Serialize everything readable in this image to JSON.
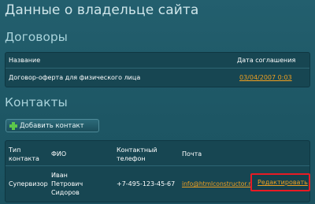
{
  "page": {
    "title": "Данные о владельце сайта"
  },
  "contracts": {
    "section_title": "Договоры",
    "headers": {
      "name": "Название",
      "date": "Дата соглашения"
    },
    "rows": [
      {
        "name": "Договор-оферта для физического лица",
        "date": "03/04/2007 0:03"
      }
    ]
  },
  "contacts": {
    "section_title": "Контакты",
    "add_button": {
      "label": "Добавить контакт",
      "icon": "plus-icon",
      "icon_color": "#5cc84a"
    },
    "headers": {
      "type_line1": "Тип",
      "type_line2": "контакта",
      "fio": "ФИО",
      "phone_line1": "Контактный",
      "phone_line2": "телефон",
      "email": "Почта"
    },
    "rows": [
      {
        "type": "Супервизор",
        "fio_line1": "Иван",
        "fio_line2": "Петрович",
        "fio_line3": "Сидоров",
        "phone": "+7-495-123-45-67",
        "email": "info@htmlconstructor.ru",
        "edit_label": "Редактировать"
      }
    ]
  },
  "colors": {
    "background": "#1f5c6b",
    "panel": "#174652",
    "link": "#f0a020",
    "highlight_border": "#e81b24"
  }
}
